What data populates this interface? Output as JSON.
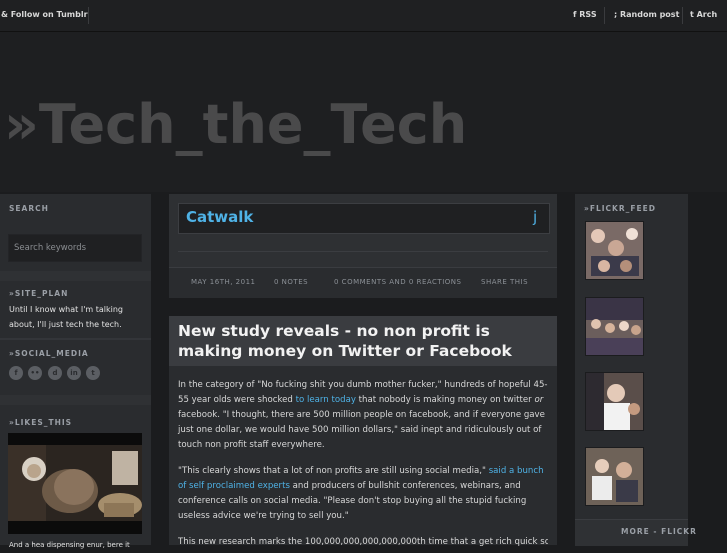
{
  "topbar": {
    "follow": "& Follow on Tumblr",
    "rss": "f RSS",
    "random": "; Random post",
    "archive": "t Arch"
  },
  "site": {
    "title": "»Tech_the_Tech"
  },
  "sidebar": {
    "search_head": "SEARCH",
    "search_placeholder": "Search keywords",
    "site_plan_head": "»SITE_PLAN",
    "site_plan_text": "Until I know what I'm talking about, I'll just tech the tech.",
    "social_head": "»SOCIAL_MEDIA",
    "social_icons": [
      "facebook-icon",
      "flickr-icon",
      "digg-icon",
      "linkedin-icon",
      "tumblr-icon"
    ],
    "likes_head": "»LIKES_THIS",
    "likes_caption": "And a hea dispensing enur, bere it"
  },
  "post": {
    "title": "Catwalk",
    "title_icon": "j",
    "date": "MAY 16TH, 2011",
    "notes": "0 NOTES",
    "comments": "0 COMMENTS AND 0 REACTIONS",
    "share": "SHARE THIS"
  },
  "article": {
    "title": "New study reveals - no non profit is making money on Twitter or Facebook",
    "p1_a": "In the category of \"No fucking shit you dumb mother fucker,\" hundreds of hopeful 45-55 year olds were shocked ",
    "p1_link": "to learn today",
    "p1_b": " that nobody is making money on twitter ",
    "p1_or": "or",
    "p1_c": " facebook. \"I thought, there are 500 million people on facebook, and if everyone gave just one dollar, we would have 500 million dollars,\" said inept and ridiculously out of touch non profit staff everywhere.",
    "p2_a": "\"This clearly shows that a lot of non profits are still using social media,\" ",
    "p2_link": "said a bunch of self proclaimed experts",
    "p2_b": " and producers of bullshit conferences, webinars, and conference calls on social media. \"Please don't stop buying all the stupid fucking useless advice we're trying to sell you.\"",
    "p3": "This new research marks the 100,000,000,000,000,000th time that a get rich quick scheme"
  },
  "flickr": {
    "head": "»FLICKR_FEED",
    "more": "MORE - FLICKR"
  }
}
